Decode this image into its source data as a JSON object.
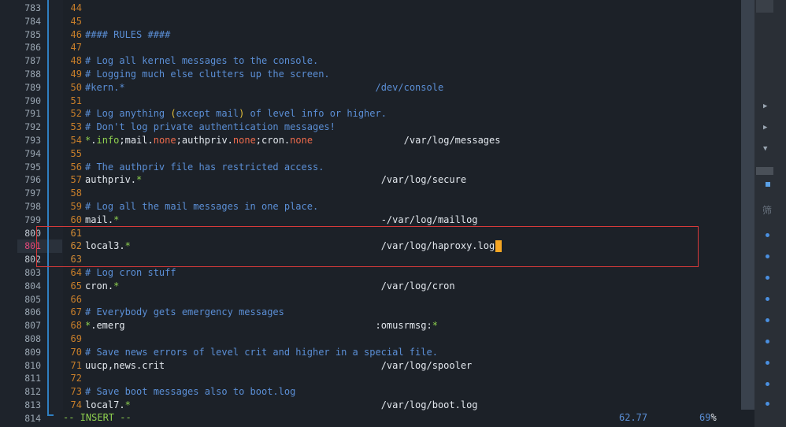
{
  "gutter_outer": [
    "783",
    "784",
    "785",
    "786",
    "787",
    "788",
    "789",
    "790",
    "791",
    "792",
    "793",
    "794",
    "795",
    "796",
    "797",
    "798",
    "799",
    "800",
    "801",
    "802",
    "803",
    "804",
    "805",
    "806",
    "807",
    "808",
    "809",
    "810",
    "811",
    "812",
    "813",
    "814"
  ],
  "lines": [
    {
      "n": "44",
      "parts": []
    },
    {
      "n": "45",
      "parts": []
    },
    {
      "n": "46",
      "parts": [
        {
          "c": "comment",
          "t": "#### RULES ####"
        }
      ]
    },
    {
      "n": "47",
      "parts": []
    },
    {
      "n": "48",
      "parts": [
        {
          "c": "comment",
          "t": "# Log all kernel messages to the console."
        }
      ]
    },
    {
      "n": "49",
      "parts": [
        {
          "c": "comment",
          "t": "# Logging much else clutters up the screen."
        }
      ]
    },
    {
      "n": "50",
      "parts": [
        {
          "c": "comment",
          "t": "#kern.*                                            "
        },
        {
          "c": "console",
          "t": "/dev/console"
        }
      ]
    },
    {
      "n": "51",
      "parts": []
    },
    {
      "n": "52",
      "parts": [
        {
          "c": "comment",
          "t": "# Log anything "
        },
        {
          "c": "paren",
          "t": "("
        },
        {
          "c": "comment",
          "t": "except mail"
        },
        {
          "c": "paren",
          "t": ")"
        },
        {
          "c": "comment",
          "t": " of level info or higher."
        }
      ]
    },
    {
      "n": "53",
      "parts": [
        {
          "c": "comment",
          "t": "# Don't log private authentication messages!"
        }
      ]
    },
    {
      "n": "54",
      "parts": [
        {
          "c": "star",
          "t": "*"
        },
        {
          "c": "text",
          "t": "."
        },
        {
          "c": "star",
          "t": "info"
        },
        {
          "c": "text",
          "t": ";mail."
        },
        {
          "c": "none",
          "t": "none"
        },
        {
          "c": "text",
          "t": ";authpriv."
        },
        {
          "c": "none",
          "t": "none"
        },
        {
          "c": "text",
          "t": ";cron."
        },
        {
          "c": "none",
          "t": "none"
        },
        {
          "c": "text",
          "t": "                "
        },
        {
          "c": "path",
          "t": "/var/log/messages"
        }
      ]
    },
    {
      "n": "55",
      "parts": []
    },
    {
      "n": "56",
      "parts": [
        {
          "c": "comment",
          "t": "# The authpriv file has restricted access."
        }
      ]
    },
    {
      "n": "57",
      "parts": [
        {
          "c": "text",
          "t": "authpriv."
        },
        {
          "c": "star",
          "t": "*"
        },
        {
          "c": "text",
          "t": "                                          "
        },
        {
          "c": "path",
          "t": "/var/log/secure"
        }
      ]
    },
    {
      "n": "58",
      "parts": []
    },
    {
      "n": "59",
      "parts": [
        {
          "c": "comment",
          "t": "# Log all the mail messages in one place."
        }
      ]
    },
    {
      "n": "60",
      "parts": [
        {
          "c": "text",
          "t": "mail."
        },
        {
          "c": "star",
          "t": "*"
        },
        {
          "c": "text",
          "t": "                                              "
        },
        {
          "c": "path",
          "t": "-/var/log/maillog"
        }
      ]
    },
    {
      "n": "61",
      "parts": []
    },
    {
      "n": "62",
      "parts": [
        {
          "c": "text",
          "t": "local3."
        },
        {
          "c": "star",
          "t": "*"
        },
        {
          "c": "text",
          "t": "                                            "
        },
        {
          "c": "path",
          "t": "/var/log/haproxy.log"
        }
      ],
      "cursor": true
    },
    {
      "n": "63",
      "parts": []
    },
    {
      "n": "64",
      "parts": [
        {
          "c": "comment",
          "t": "# Log cron stuff"
        }
      ]
    },
    {
      "n": "65",
      "parts": [
        {
          "c": "text",
          "t": "cron."
        },
        {
          "c": "star",
          "t": "*"
        },
        {
          "c": "text",
          "t": "                                              "
        },
        {
          "c": "path",
          "t": "/var/log/cron"
        }
      ]
    },
    {
      "n": "66",
      "parts": []
    },
    {
      "n": "67",
      "parts": [
        {
          "c": "comment",
          "t": "# Everybody gets emergency messages"
        }
      ]
    },
    {
      "n": "68",
      "parts": [
        {
          "c": "star",
          "t": "*"
        },
        {
          "c": "text",
          "t": ".emerg                                            "
        },
        {
          "c": "text",
          "t": ":omusrmsg:"
        },
        {
          "c": "star",
          "t": "*"
        }
      ]
    },
    {
      "n": "69",
      "parts": []
    },
    {
      "n": "70",
      "parts": [
        {
          "c": "comment",
          "t": "# Save news errors of level crit and higher in a special file."
        }
      ]
    },
    {
      "n": "71",
      "parts": [
        {
          "c": "text",
          "t": "uucp,news.crit                                      "
        },
        {
          "c": "path",
          "t": "/var/log/spooler"
        }
      ]
    },
    {
      "n": "72",
      "parts": []
    },
    {
      "n": "73",
      "parts": [
        {
          "c": "comment",
          "t": "# Save boot messages also to boot.log"
        }
      ]
    },
    {
      "n": "74",
      "parts": [
        {
          "c": "text",
          "t": "local7."
        },
        {
          "c": "star",
          "t": "*"
        },
        {
          "c": "text",
          "t": "                                            "
        },
        {
          "c": "path",
          "t": "/var/log/boot.log"
        }
      ]
    }
  ],
  "status": {
    "mode": "-- INSERT --",
    "position": "62.77",
    "percent": "69",
    "percent_sym": "%"
  },
  "side_label": "筛",
  "colors": {
    "background": "#1c2128",
    "comment": "#5b8fd6",
    "line_number": "#c97f2a",
    "selection_box": "#d63a3a",
    "cursor": "#f5a623"
  }
}
